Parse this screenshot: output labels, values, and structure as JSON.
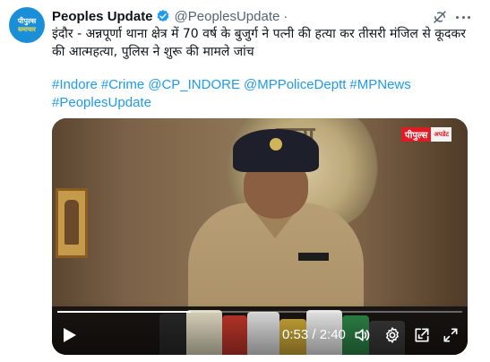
{
  "account": {
    "avatar_line1": "पीपुल्स",
    "avatar_line2": "समाचार",
    "display_name": "Peoples Update",
    "handle": "@PeoplesUpdate",
    "separator": "·"
  },
  "tweet": {
    "text": "इंदौर - अन्नपूर्णा थाना क्षेत्र में 70 वर्ष के बुजुर्ग ने पत्नी की हत्या कर तीसरी मंजिल से कूदकर की आत्महत्या, पुलिस ने शुरू की मामले जांच",
    "hashtags": [
      "#Indore",
      "#Crime",
      "@CP_INDORE",
      "@MPPoliceDeptt",
      "#MPNews",
      "#PeoplesUpdate"
    ]
  },
  "video": {
    "watermark_main": "पीपुल्स",
    "watermark_sub": "अपडेट",
    "emblem_text": "सत्य",
    "current_time": "0:53",
    "duration": "2:40",
    "time_display": "0:53 / 2:40",
    "progress_fraction": 0.33
  },
  "colors": {
    "link": "#1d9bf0",
    "verified": "#1d9bf0",
    "avatar_bg": "#1a8fd8",
    "watermark_red": "#e01b24"
  },
  "icons": [
    "verified-badge-icon",
    "grok-icon",
    "more-icon",
    "play-icon",
    "volume-icon",
    "settings-icon",
    "picture-in-picture-icon",
    "fullscreen-icon"
  ]
}
